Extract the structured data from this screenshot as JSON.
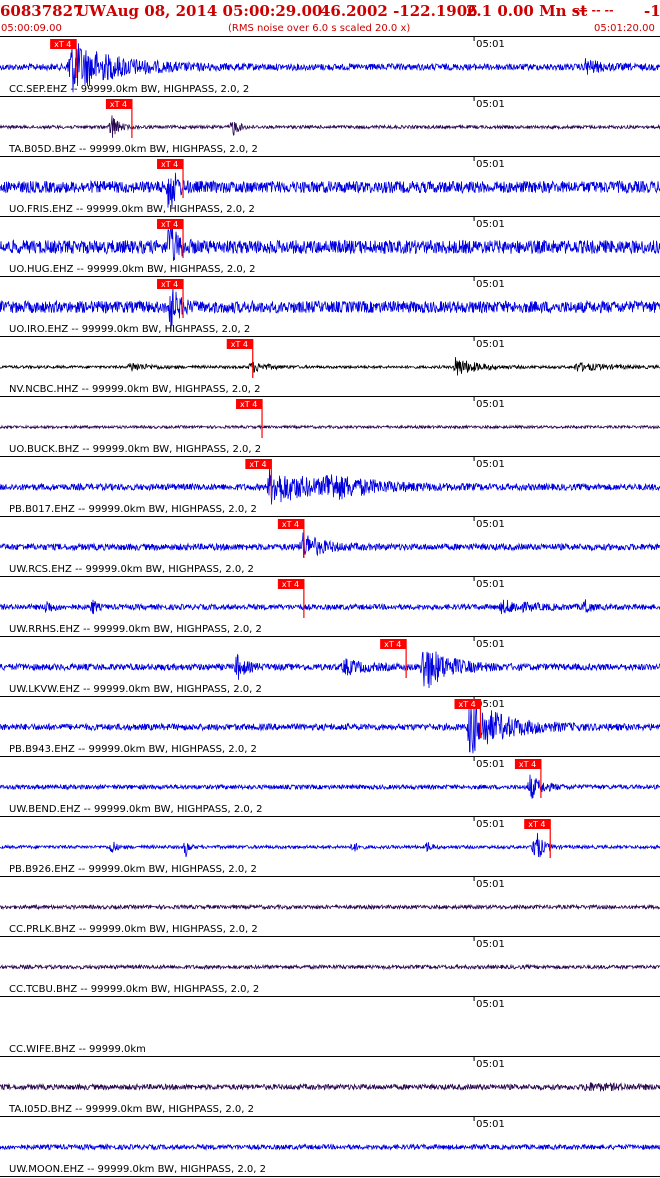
{
  "header": {
    "event_id": "60837827",
    "network": "UW",
    "datetime": "Aug 08, 2014 05:00:29.00",
    "lat_lon": "46.2002 -122.1906",
    "magnitude": "2.1 0.00 Mn st",
    "dashes": "--- -- --",
    "tail": "-1",
    "start_time": "05:00:09.00",
    "rms_note": "(RMS noise over 6.0 s scaled 20.0 x)",
    "end_time": "05:01:20.00"
  },
  "colors": {
    "header_red": "#cc0000",
    "trace_blue": "#0000e0",
    "trace_black": "#000000",
    "trace_purple": "#2a0a50",
    "pick_red": "#ff0000"
  },
  "chart_data": {
    "type": "line",
    "x_unit": "seconds",
    "x_start": "05:00:09.00",
    "x_end": "05:01:20.00",
    "xlim": [
      0,
      71
    ],
    "mid_tick_label": "05:01",
    "mid_tick_seconds": 51,
    "pick_label": "xT 4",
    "traces": [
      {
        "label": "CC.SEP.EHZ -- 99999.0km BW, HIGHPASS, 2.0, 2",
        "color": "#0000e0",
        "noise": 0.12,
        "pick_s": 5.5,
        "events": [
          {
            "t": 7.5,
            "amp": 0.95,
            "dur": 4.5
          },
          {
            "t": 63,
            "amp": 0.25,
            "dur": 1.5
          }
        ]
      },
      {
        "label": "TA.B05D.BHZ -- 99999.0km BW, HIGHPASS, 2.0, 2",
        "color": "#2a0a50",
        "noise": 0.06,
        "pick_s": 11.5,
        "events": [
          {
            "t": 12,
            "amp": 0.55,
            "dur": 0.6
          },
          {
            "t": 25,
            "amp": 0.35,
            "dur": 0.6
          }
        ]
      },
      {
        "label": "UO.FRIS.EHZ -- 99999.0km BW, HIGHPASS, 2.0, 2",
        "color": "#0000e0",
        "noise": 0.22,
        "pick_s": 17.0,
        "events": [
          {
            "t": 18.2,
            "amp": 1.0,
            "dur": 0.6
          }
        ]
      },
      {
        "label": "UO.HUG.EHZ -- 99999.0km BW, HIGHPASS, 2.0, 2",
        "color": "#0000e0",
        "noise": 0.25,
        "pick_s": 17.0,
        "events": [
          {
            "t": 18.2,
            "amp": 1.0,
            "dur": 0.7
          }
        ]
      },
      {
        "label": "UO.IRO.EHZ -- 99999.0km BW, HIGHPASS, 2.0, 2",
        "color": "#0000e0",
        "noise": 0.22,
        "pick_s": 17.0,
        "events": [
          {
            "t": 18.2,
            "amp": 1.0,
            "dur": 0.7
          }
        ]
      },
      {
        "label": "NV.NCBC.HHZ -- 99999.0km BW, HIGHPASS, 2.0, 2",
        "color": "#000000",
        "noise": 0.05,
        "pick_s": 24.5,
        "events": [
          {
            "t": 14,
            "amp": 0.15,
            "dur": 2
          },
          {
            "t": 27,
            "amp": 0.2,
            "dur": 1.5
          },
          {
            "t": 49,
            "amp": 0.35,
            "dur": 2
          },
          {
            "t": 62,
            "amp": 0.15,
            "dur": 3
          }
        ]
      },
      {
        "label": "UO.BUCK.BHZ -- 99999.0km BW, HIGHPASS, 2.0, 2",
        "color": "#2a0a50",
        "noise": 0.05,
        "pick_s": 25.5,
        "events": []
      },
      {
        "label": "PB.B017.EHZ -- 99999.0km BW, HIGHPASS, 2.0, 2",
        "color": "#0000e0",
        "noise": 0.12,
        "pick_s": 26.5,
        "events": [
          {
            "t": 29,
            "amp": 0.6,
            "dur": 5
          },
          {
            "t": 35,
            "amp": 0.35,
            "dur": 4
          }
        ]
      },
      {
        "label": "UW.RCS.EHZ -- 99999.0km BW, HIGHPASS, 2.0, 2",
        "color": "#0000e0",
        "noise": 0.12,
        "pick_s": 30.0,
        "events": [
          {
            "t": 32.5,
            "amp": 0.5,
            "dur": 1.8
          }
        ]
      },
      {
        "label": "UW.RRHS.EHZ -- 99999.0km BW, HIGHPASS, 2.0, 2",
        "color": "#0000e0",
        "noise": 0.1,
        "pick_s": 30.0,
        "events": [
          {
            "t": 5,
            "amp": 0.25,
            "dur": 0.5
          },
          {
            "t": 10,
            "amp": 0.3,
            "dur": 0.3
          },
          {
            "t": 54,
            "amp": 0.2,
            "dur": 3
          },
          {
            "t": 63,
            "amp": 0.4,
            "dur": 0.3
          }
        ]
      },
      {
        "label": "UW.LKVW.EHZ -- 99999.0km BW, HIGHPASS, 2.0, 2",
        "color": "#0000e0",
        "noise": 0.12,
        "pick_s": 41.0,
        "events": [
          {
            "t": 25.5,
            "amp": 0.45,
            "dur": 0.8
          },
          {
            "t": 37,
            "amp": 0.25,
            "dur": 2
          },
          {
            "t": 45.5,
            "amp": 0.85,
            "dur": 2.5
          }
        ]
      },
      {
        "label": "PB.B943.EHZ -- 99999.0km BW, HIGHPASS, 2.0, 2",
        "color": "#0000e0",
        "noise": 0.12,
        "pick_s": 49.0,
        "events": [
          {
            "t": 50.5,
            "amp": 1.0,
            "dur": 3.5
          }
        ]
      },
      {
        "label": "UW.BEND.EHZ -- 99999.0km BW, HIGHPASS, 2.0, 2",
        "color": "#0000e0",
        "noise": 0.08,
        "pick_s": 55.5,
        "events": [
          {
            "t": 57,
            "amp": 0.45,
            "dur": 1.2
          }
        ]
      },
      {
        "label": "PB.B926.EHZ -- 99999.0km BW, HIGHPASS, 2.0, 2",
        "color": "#0000e0",
        "noise": 0.06,
        "pick_s": 56.5,
        "events": [
          {
            "t": 12,
            "amp": 0.3,
            "dur": 0.4
          },
          {
            "t": 20,
            "amp": 0.35,
            "dur": 0.3
          },
          {
            "t": 38,
            "amp": 0.2,
            "dur": 0.4
          },
          {
            "t": 46,
            "amp": 0.2,
            "dur": 0.4
          },
          {
            "t": 57.5,
            "amp": 0.9,
            "dur": 0.6
          }
        ]
      },
      {
        "label": "CC.PRLK.BHZ -- 99999.0km BW, HIGHPASS, 2.0, 2",
        "color": "#2a0a50",
        "noise": 0.07,
        "pick_s": null,
        "events": []
      },
      {
        "label": "CC.TCBU.BHZ -- 99999.0km BW, HIGHPASS, 2.0, 2",
        "color": "#2a0a50",
        "noise": 0.07,
        "pick_s": null,
        "events": []
      },
      {
        "label": "CC.WIFE.BHZ -- 99999.0km",
        "color": "#0000e0",
        "noise": 0.0,
        "pick_s": null,
        "events": []
      },
      {
        "label": "TA.I05D.BHZ -- 99999.0km BW, HIGHPASS, 2.0, 2",
        "color": "#2a0a50",
        "noise": 0.1,
        "pick_s": null,
        "events": [
          {
            "t": 63,
            "amp": 0.1,
            "dur": 4
          }
        ]
      },
      {
        "label": "UW.MOON.EHZ -- 99999.0km BW, HIGHPASS, 2.0, 2",
        "color": "#0000e0",
        "noise": 0.09,
        "pick_s": null,
        "events": []
      }
    ]
  }
}
